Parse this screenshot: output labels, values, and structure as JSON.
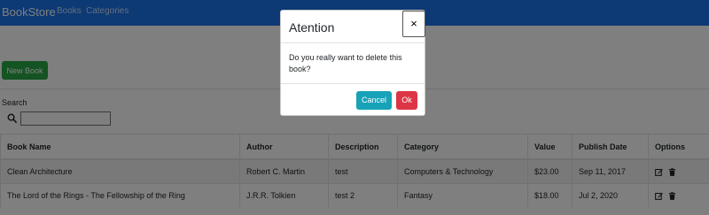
{
  "navbar": {
    "brand": "BookStore",
    "links": [
      "Books",
      "Categories"
    ]
  },
  "toolbar": {
    "new_book_label": "New Book"
  },
  "search": {
    "label": "Search",
    "value": ""
  },
  "table": {
    "headers": [
      "Book Name",
      "Author",
      "Description",
      "Category",
      "Value",
      "Publish Date",
      "Options"
    ],
    "rows": [
      [
        "Clean Architecture",
        "Robert C. Martin",
        "test",
        "Computers & Technology",
        "$23.00",
        "Sep 11, 2017"
      ],
      [
        "The Lord of the Rings - The Fellowship of the Ring",
        "J.R.R. Tolkien",
        "test 2",
        "Fantasy",
        "$18.00",
        "Jul 2, 2020"
      ]
    ]
  },
  "modal": {
    "title": "Atention",
    "close": "×",
    "body": "Do you really want to delete this book?",
    "cancel_label": "Cancel",
    "ok_label": "Ok"
  },
  "colors": {
    "navbar": "#1a73e8",
    "new_button": "#28a745",
    "cancel_button": "#17a2b8",
    "ok_button": "#dc3545"
  },
  "icons": [
    "search-icon",
    "edit-icon",
    "trash-icon",
    "close-icon"
  ]
}
